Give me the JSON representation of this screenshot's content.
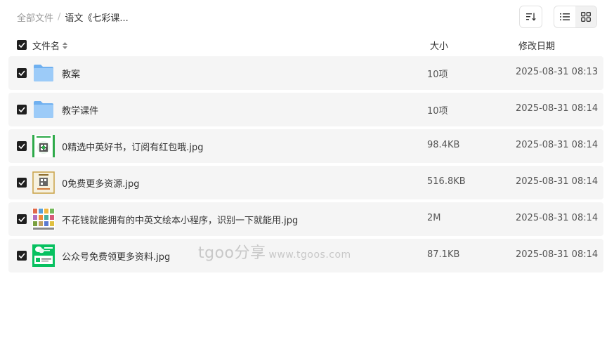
{
  "breadcrumb": {
    "root": "全部文件",
    "separator": "/",
    "current": "语文《七彩课..."
  },
  "toolbar": {
    "sort_icon": "sort-icon",
    "list_view_icon": "list-view-icon",
    "grid_view_icon": "grid-view-icon"
  },
  "header": {
    "name": "文件名",
    "size": "大小",
    "date": "修改日期"
  },
  "files": [
    {
      "name": "教案",
      "size": "10项",
      "date": "2025-08-31 08:13",
      "type": "folder"
    },
    {
      "name": "教学课件",
      "size": "10项",
      "date": "2025-08-31 08:14",
      "type": "folder"
    },
    {
      "name": "0精选中英好书，订阅有红包哦.jpg",
      "size": "98.4KB",
      "date": "2025-08-31 08:14",
      "type": "image-qr"
    },
    {
      "name": "0免费更多资源.jpg",
      "size": "516.8KB",
      "date": "2025-08-31 08:14",
      "type": "image-poster"
    },
    {
      "name": "不花钱就能拥有的中英文绘本小程序，识别一下就能用.jpg",
      "size": "2M",
      "date": "2025-08-31 08:14",
      "type": "image-books"
    },
    {
      "name": "公众号免费领更多资料.jpg",
      "size": "87.1KB",
      "date": "2025-08-31 08:14",
      "type": "image-wechat"
    }
  ],
  "watermark": {
    "brand": "tgoo分享",
    "url": "www.tgoos.com"
  },
  "colors": {
    "checkbox": "#1f1f1f",
    "row_bg": "#f5f5f5",
    "folder": "#8cc1f5",
    "wechat_green": "#07c160"
  }
}
